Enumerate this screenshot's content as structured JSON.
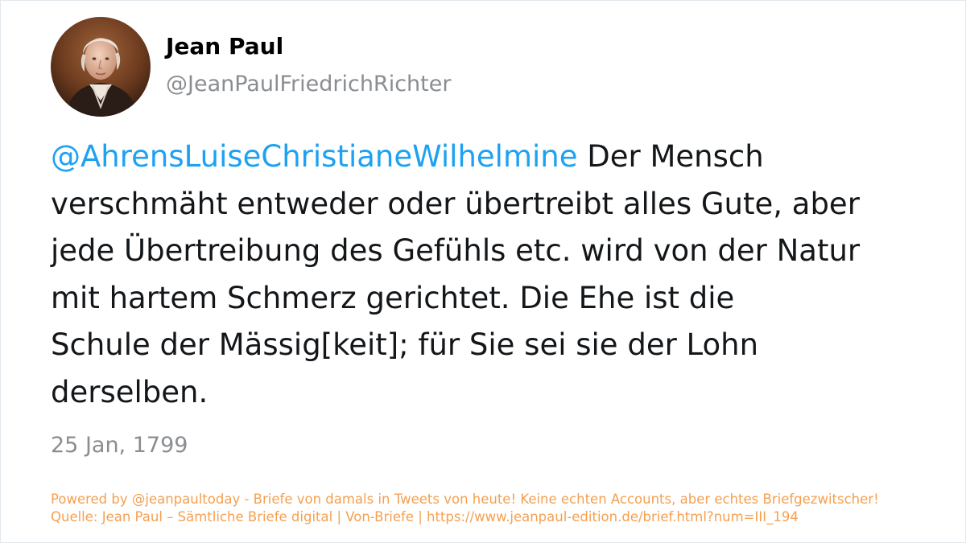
{
  "author": {
    "display_name": "Jean Paul",
    "handle": "@JeanPaulFriedrichRichter",
    "avatar_icon": "portrait-avatar"
  },
  "tweet": {
    "mention": "@AhrensLuiseChristianeWilhelmine",
    "lines": [
      " Der Mensch",
      "verschmäht entweder oder übertreibt alles Gute, aber",
      "jede Übertreibung des Gefühls etc. wird von der Natur",
      "mit hartem Schmerz gerichtet. Die Ehe ist die",
      "Schule der Mässig[keit]; für Sie sei sie der Lohn",
      "derselben."
    ],
    "date": "25 Jan, 1799"
  },
  "footer": {
    "powered_by": "Powered by @jeanpaultoday - Briefe von damals in Tweets von heute! Keine echten Accounts, aber echtes Briefgezwitscher!",
    "source": "Quelle: Jean Paul – Sämtliche Briefe digital | Von-Briefe | https://www.jeanpaul-edition.de/brief.html?num=III_194"
  },
  "colors": {
    "mention": "#1da1f2",
    "text": "#14171a",
    "muted": "#8a8d91",
    "footer": "#f5a050"
  }
}
